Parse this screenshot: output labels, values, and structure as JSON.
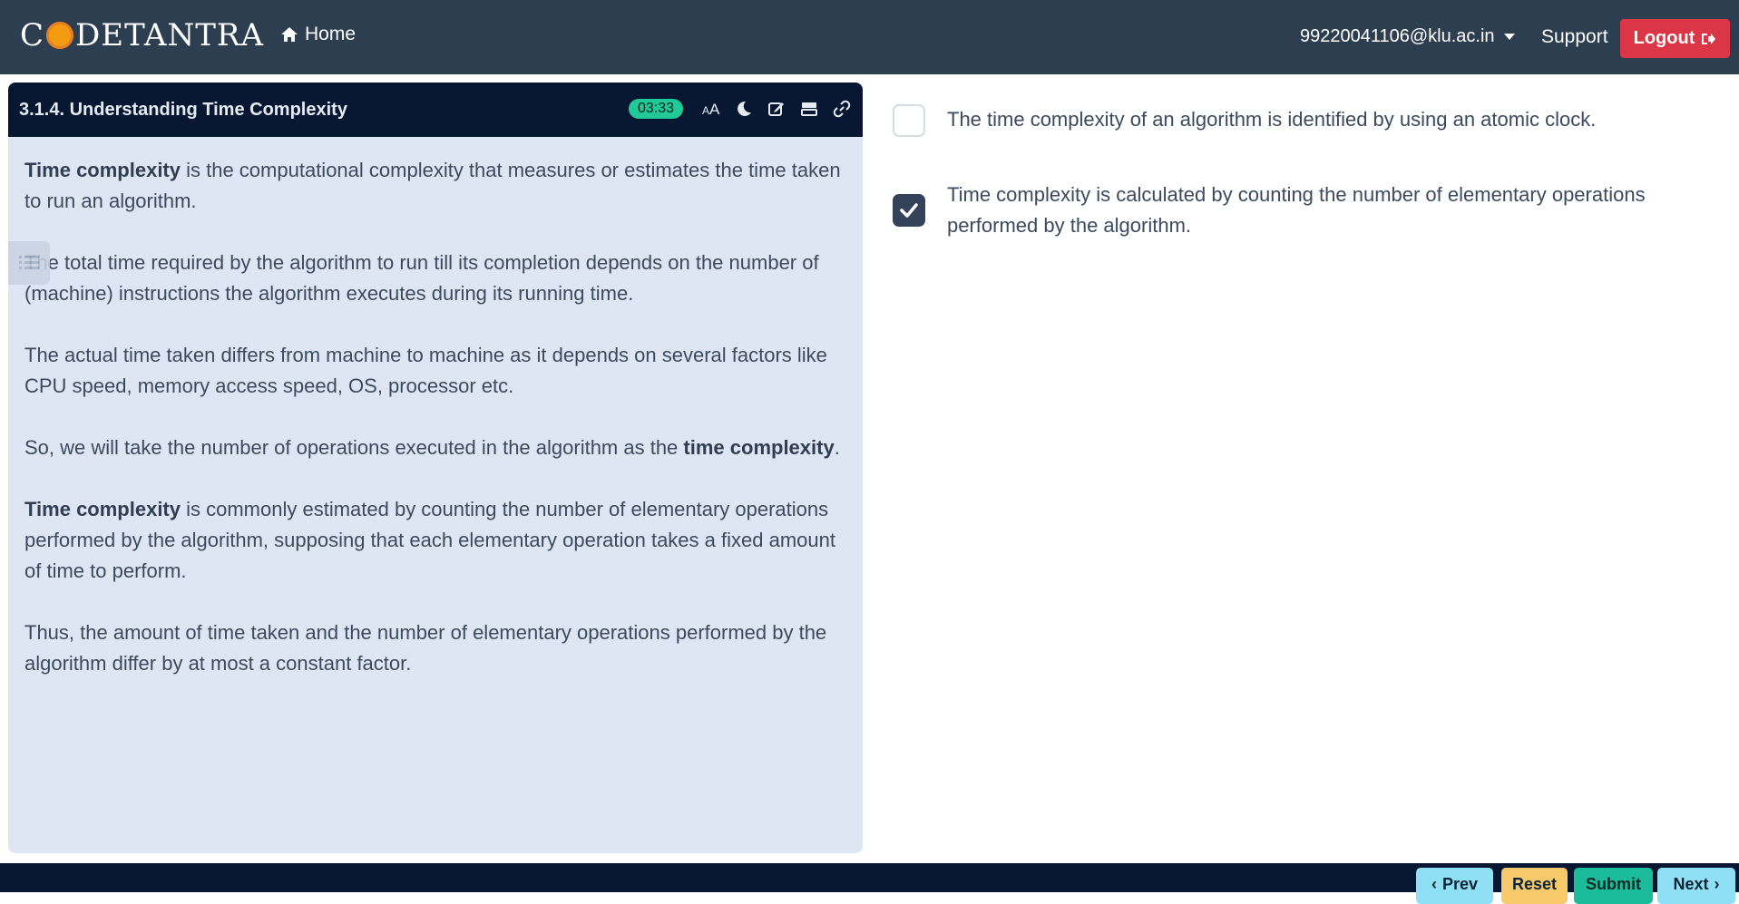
{
  "topbar": {
    "logo_text_left": "C",
    "logo_text_right": "DETANTRA",
    "home_label": "Home",
    "user_email": "99220041106@klu.ac.in",
    "support_label": "Support",
    "logout_label": "Logout"
  },
  "panel": {
    "title": "3.1.4. Understanding Time Complexity",
    "timer": "03:33",
    "icons": [
      "font-size-icon",
      "moon-icon",
      "edit-icon",
      "layout-icon",
      "link-icon"
    ],
    "paragraphs": [
      {
        "bold_lead": "Time complexity",
        "text": " is the computational complexity that measures or estimates the time taken to run an algorithm."
      },
      {
        "bold_lead": "",
        "text": "The total time required by the algorithm to run till its completion depends on the number of (machine) instructions the algorithm executes during its running time."
      },
      {
        "bold_lead": "",
        "text": "The actual time taken differs from machine to machine as it depends on several factors like CPU speed, memory access speed, OS, processor etc."
      },
      {
        "bold_lead": "",
        "text": "So, we will take the number of operations executed in the algorithm as the ",
        "bold_tail": "time complexity",
        "tail": "."
      },
      {
        "bold_lead": "Time complexity",
        "text": " is commonly estimated by counting the number of elementary operations performed by the algorithm, supposing that each elementary operation takes a fixed amount of time to perform."
      },
      {
        "bold_lead": "",
        "text": "Thus, the amount of time taken and the number of elementary operations performed by the algorithm differ by at most a constant factor."
      }
    ]
  },
  "options": [
    {
      "text": "The time complexity of an algorithm is identified by using an atomic clock.",
      "checked": false
    },
    {
      "text": "Time complexity is calculated by counting the number of elementary operations performed by the algorithm.",
      "checked": true
    }
  ],
  "footer": {
    "prev_label": "Prev",
    "reset_label": "Reset",
    "submit_label": "Submit",
    "next_label": "Next"
  }
}
